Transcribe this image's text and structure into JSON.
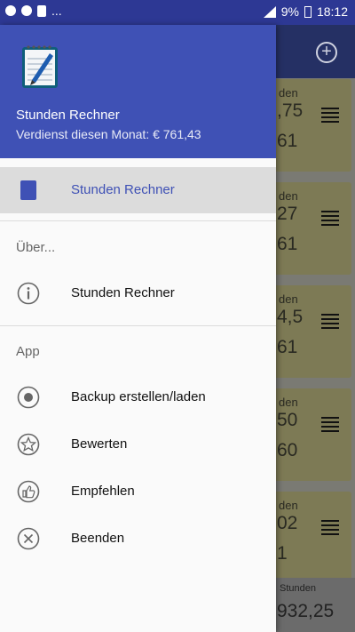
{
  "status_bar": {
    "time": "18:12",
    "battery": "9%",
    "icons": [
      "chrome-icon",
      "messenger-icon",
      "sim-icon",
      "more-icon"
    ]
  },
  "background_list": {
    "cards": [
      {
        "l1": "den",
        "l2": ",75",
        "l3": "61"
      },
      {
        "l1": "den",
        "l2": "27",
        "l3": "61"
      },
      {
        "l1": "den",
        "l2": "4,5",
        "l3": "61"
      },
      {
        "l1": "den",
        "l2": "50",
        "l3": "60"
      },
      {
        "l1": "den",
        "l2": "02",
        "l3": "1"
      }
    ],
    "footer_label": "Stunden",
    "footer_value": "932,25"
  },
  "drawer": {
    "header": {
      "title": "Stunden Rechner",
      "subtitle": "Verdienst diesen Monat: € 761,43"
    },
    "primary_item": {
      "label": "Stunden Rechner"
    },
    "section_about": {
      "title": "Über...",
      "items": [
        {
          "label": "Stunden Rechner",
          "icon": "info-icon"
        }
      ]
    },
    "section_app": {
      "title": "App",
      "items": [
        {
          "label": "Backup erstellen/laden",
          "icon": "backup-icon"
        },
        {
          "label": "Bewerten",
          "icon": "star-icon"
        },
        {
          "label": "Empfehlen",
          "icon": "thumbs-up-icon"
        },
        {
          "label": "Beenden",
          "icon": "close-icon"
        }
      ]
    }
  }
}
